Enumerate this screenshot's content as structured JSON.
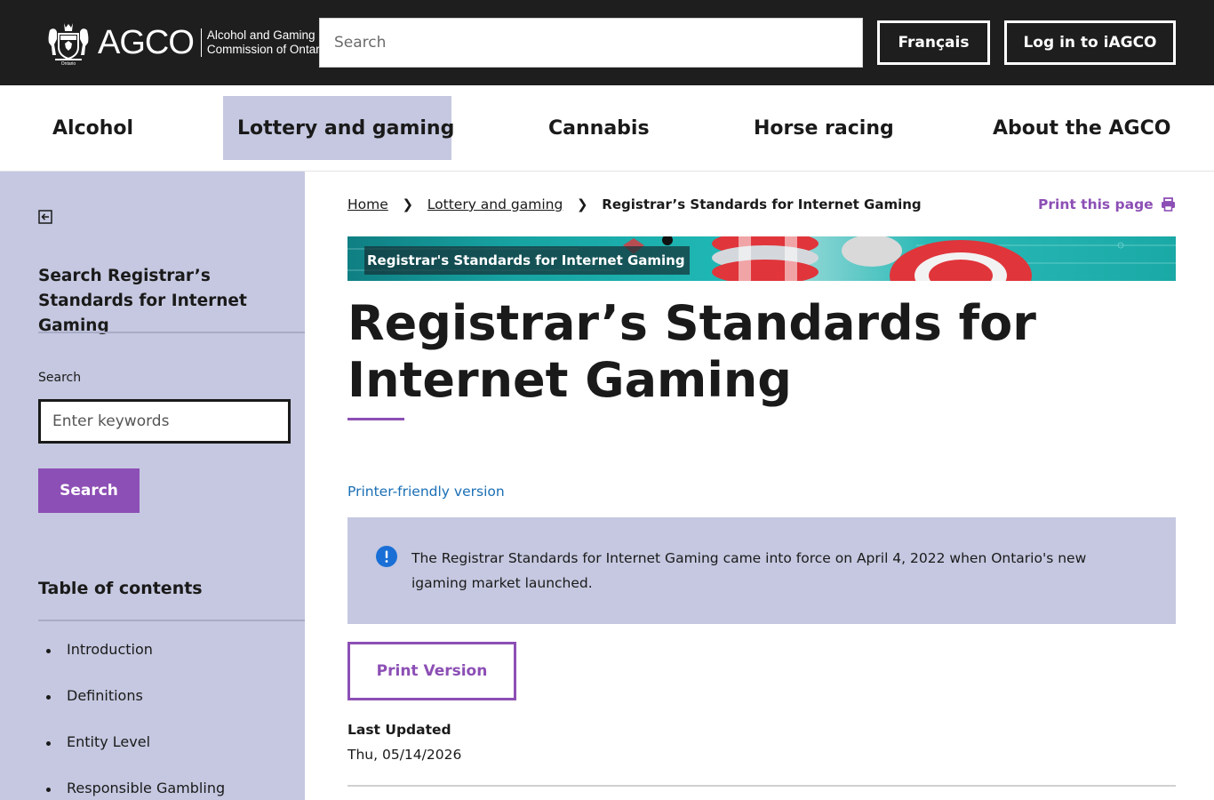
{
  "header": {
    "logo_word": "AGCO",
    "logo_subtitle_line1": "Alcohol and Gaming",
    "logo_subtitle_line2": "Commission of Ontario",
    "search_placeholder": "Search",
    "french_label": "Français",
    "login_label": "Log in to iAGCO"
  },
  "nav": {
    "items": [
      {
        "label": "Alcohol",
        "active": false
      },
      {
        "label": "Lottery and gaming",
        "active": true
      },
      {
        "label": "Cannabis",
        "active": false
      },
      {
        "label": "Horse racing",
        "active": false
      },
      {
        "label": "About the AGCO",
        "active": false
      }
    ]
  },
  "sidebar": {
    "search_title": "Search Registrar’s Standards for Internet Gaming",
    "search_label": "Search",
    "search_placeholder": "Enter keywords",
    "search_button": "Search",
    "toc_title": "Table of contents",
    "toc_items": [
      "Introduction",
      "Definitions",
      "Entity Level",
      "Responsible Gambling"
    ]
  },
  "breadcrumb": {
    "home": "Home",
    "section": "Lottery and gaming",
    "current": "Registrar’s Standards for Internet Gaming"
  },
  "print_page_label": "Print this page",
  "banner_label": "Registrar's Standards for Internet Gaming",
  "page_title": "Registrar’s Standards for Internet Gaming",
  "printer_friendly_label": "Printer-friendly version",
  "notice_text": "The Registrar Standards for Internet Gaming came into force on April 4, 2022 when Ontario's new igaming market launched.",
  "print_version_label": "Print Version",
  "last_updated": {
    "label": "Last Updated",
    "value": "Thu, 05/14/2026"
  },
  "colors": {
    "header_bg": "#1e1e1e",
    "accent_purple": "#8c4fb5",
    "lavender": "#c5c8e0",
    "link_blue": "#1a6fb5",
    "info_blue": "#1a6fd6"
  },
  "icons": {
    "crest": "ontario-crest-icon",
    "collapse": "collapse-sidebar-icon",
    "breadcrumb_separator": "chevron-right-icon",
    "print": "printer-icon",
    "info": "info-icon"
  }
}
